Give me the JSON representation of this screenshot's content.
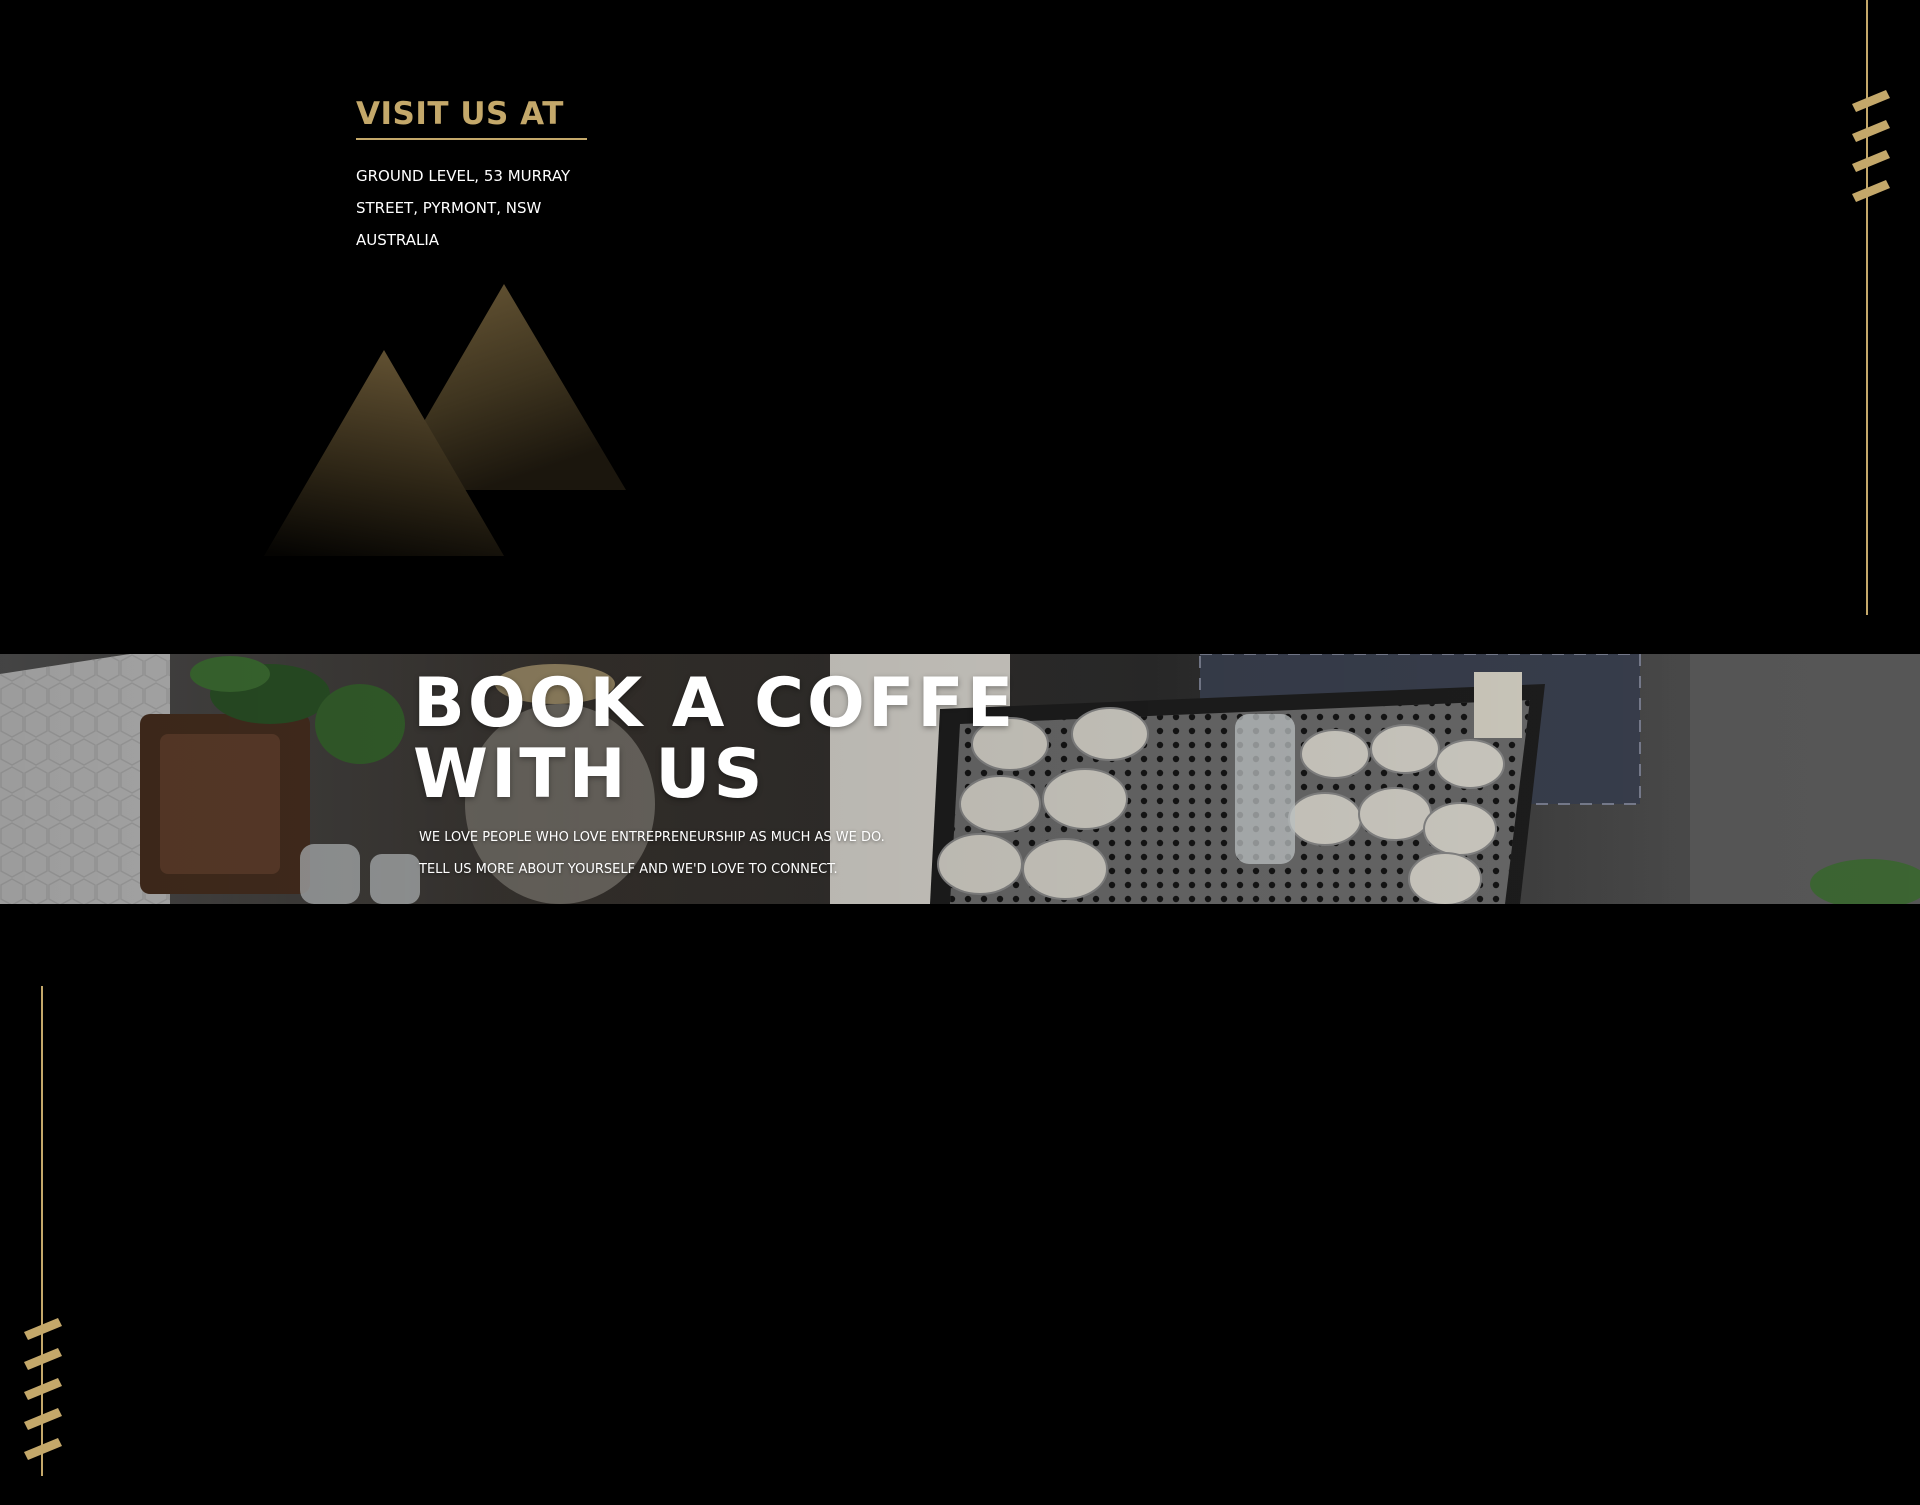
{
  "visit": {
    "title": "VISIT US AT",
    "address_lines": [
      "GROUND LEVEL, 53 MURRAY",
      "STREET, PYRMONT, NSW",
      "AUSTRALIA"
    ]
  },
  "book": {
    "title_lines": [
      "BOOK A COFFE",
      "WITH US"
    ],
    "subtitle_lines": [
      "WE LOVE PEOPLE WHO LOVE ENTREPRENEURSHIP AS MUCH AS WE DO.",
      "TELL US MORE ABOUT YOURSELF AND WE'D LOVE TO CONNECT."
    ],
    "photo_icon": "coffee-bar-photo"
  },
  "decor": {
    "accent_color": "#c4a86a",
    "background_color": "#000000",
    "pyramid_icon": "pyramids-icon",
    "dash_icon": "slash-dashes-icon"
  }
}
